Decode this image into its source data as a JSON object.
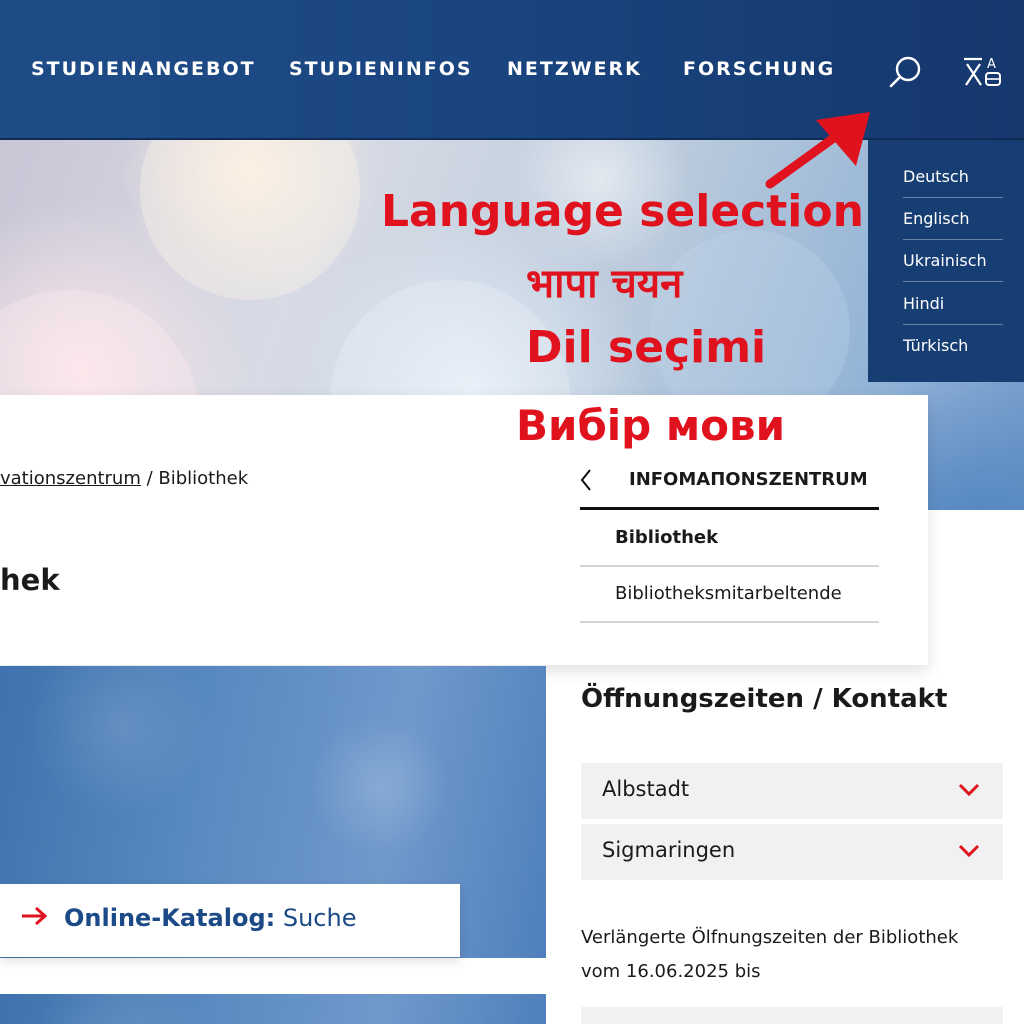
{
  "header": {
    "nav": [
      "STUDIENANGEBOT",
      "STUDIENINFOS",
      "NETZWERK",
      "FORSCHUNG"
    ],
    "icons": {
      "search": "search-icon",
      "language": "language-translate-icon"
    },
    "colors": {
      "bar": "#1a4580",
      "menu": "#173e73"
    }
  },
  "language_menu": {
    "items": [
      "Deutsch",
      "Englisch",
      "Ukrainisch",
      "Hindi",
      "Türkisch"
    ]
  },
  "annotation": {
    "lines": [
      "Language selection",
      "भापा चयन",
      "Dil seçimi",
      "Вибір мови"
    ],
    "color": "#e0121d"
  },
  "breadcrumb": {
    "link": "vationszentrum",
    "separator": " / ",
    "current": "Bibliothek"
  },
  "page": {
    "title": "hek"
  },
  "subnav": {
    "heading": "INFOMAΠONSZENTRUM",
    "items": [
      "Bibliothek",
      "Bibliotheksmitarbeltende"
    ]
  },
  "catalog": {
    "label_strong": "Online-Katalog:",
    "label_rest": " Suche"
  },
  "sidebar": {
    "heading": "Öffnungszeiten / Kontakt",
    "accordion": [
      "Albstadt",
      "Sigmaringen"
    ],
    "info": "Verlängerte Ölfnungszeiten der Bibliothek vom 16.06.2025 bis"
  }
}
